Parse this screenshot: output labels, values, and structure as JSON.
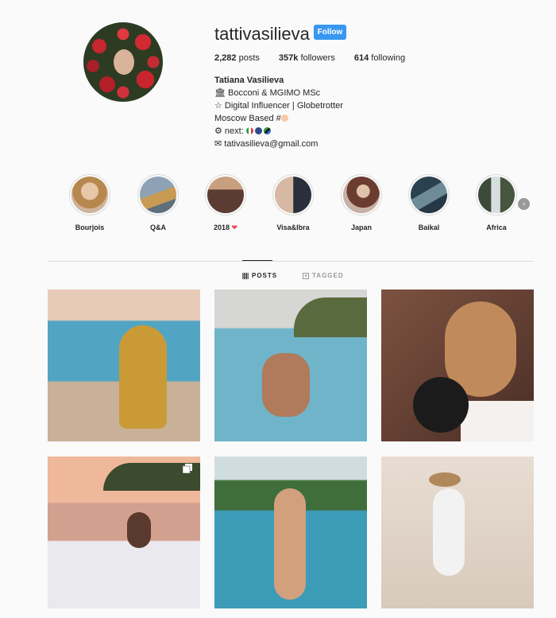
{
  "profile": {
    "username": "tattivasilieva",
    "follow_label": "Follow",
    "posts_count": "2,282",
    "posts_label": "posts",
    "followers_count": "357k",
    "followers_label": "followers",
    "following_count": "614",
    "following_label": "following",
    "full_name": "Tatiana Vasilieva",
    "bio_lines": [
      "🏛 Bocconi & MGIMO MSc",
      "☆ Digital Influencer | Globetrotter",
      "Moscow Based #",
      "⚙ next:",
      "✉ tativasilieva@gmail.com"
    ]
  },
  "highlights": [
    {
      "label": "Bourjois",
      "color": "#c9a58e"
    },
    {
      "label": "Q&A",
      "color": "#7a8fa0"
    },
    {
      "label": "2018",
      "color": "#7d5a50",
      "heart": "❤"
    },
    {
      "label": "Visa&Ibra",
      "color": "#b8a8a0"
    },
    {
      "label": "Japan",
      "color": "#9d6b5e"
    },
    {
      "label": "Baikal",
      "color": "#3f5a6b"
    },
    {
      "label": "Africa",
      "color": "#5b6f6a"
    }
  ],
  "tabs": {
    "posts": "POSTS",
    "tagged": "TAGGED"
  },
  "grid_colors": {
    "accent": "#3897f0",
    "tile_1": "#4ba4b8",
    "tile_2": "#6fb4c9",
    "tile_3": "#8c5e48",
    "tile_4": "#c2897b",
    "tile_5": "#3d9cb8",
    "tile_6": "#e8ddd3"
  }
}
